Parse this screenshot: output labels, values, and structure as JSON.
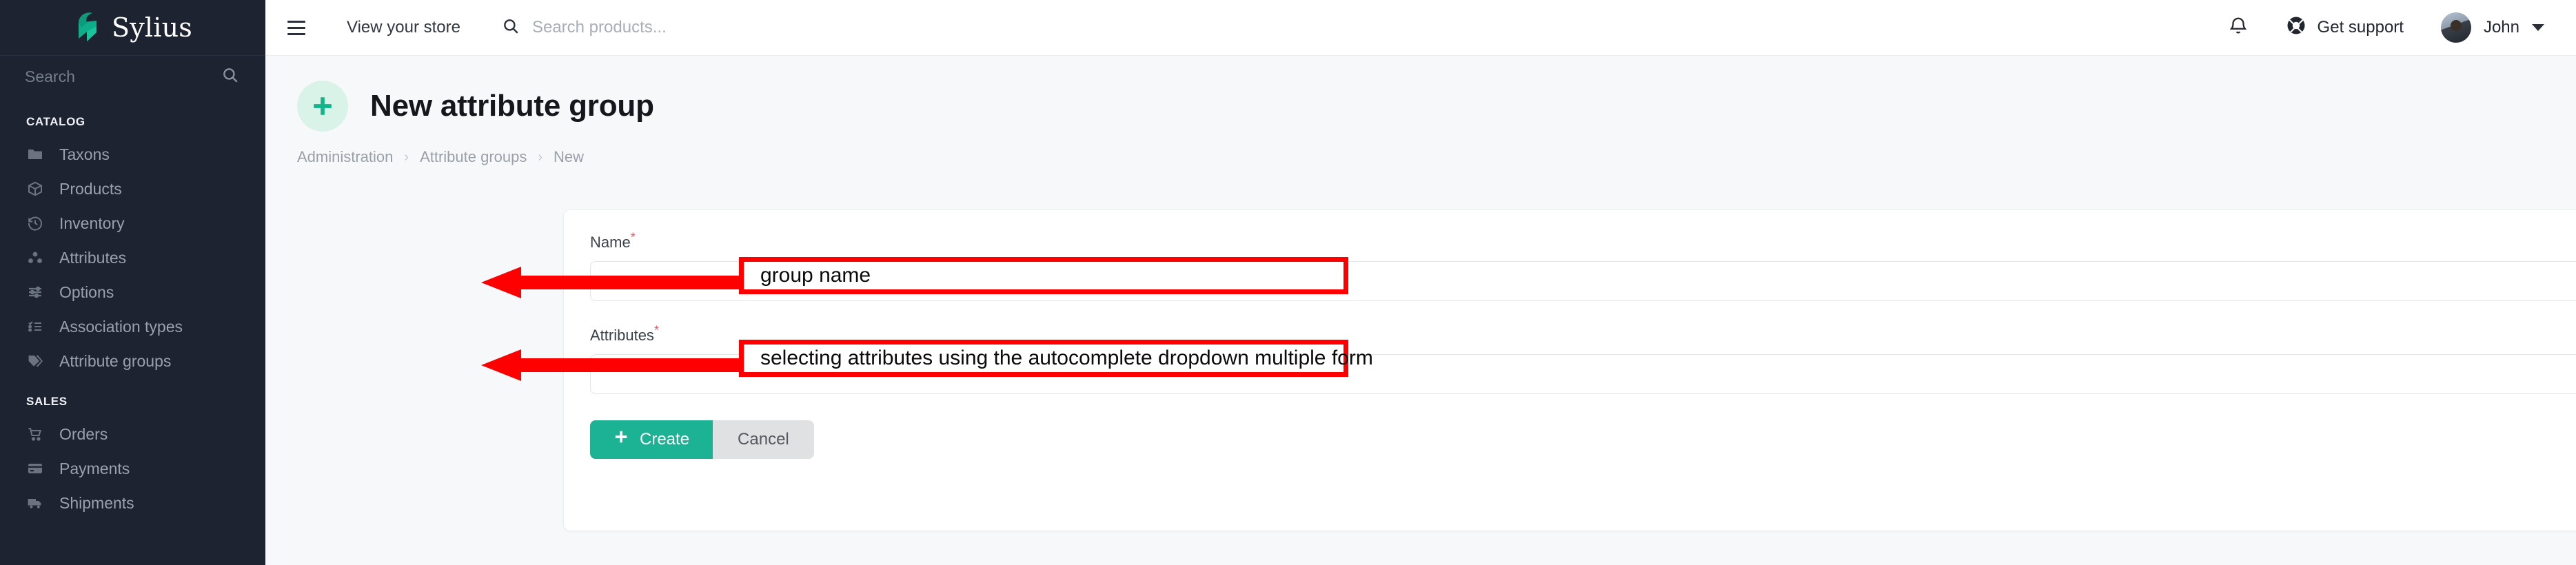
{
  "brand": {
    "name": "Sylius",
    "logo_icon": "sylius-swan-logo",
    "accent": "#1bb394"
  },
  "sidebar": {
    "search": {
      "placeholder": "Search",
      "icon": "search-icon"
    },
    "sections": [
      {
        "title": "CATALOG",
        "items": [
          {
            "label": "Taxons",
            "icon": "folder-icon"
          },
          {
            "label": "Products",
            "icon": "cube-icon"
          },
          {
            "label": "Inventory",
            "icon": "history-icon"
          },
          {
            "label": "Attributes",
            "icon": "atom-icon"
          },
          {
            "label": "Options",
            "icon": "sliders-icon"
          },
          {
            "label": "Association types",
            "icon": "checklist-icon"
          },
          {
            "label": "Attribute groups",
            "icon": "tags-icon"
          }
        ]
      },
      {
        "title": "SALES",
        "items": [
          {
            "label": "Orders",
            "icon": "cart-icon"
          },
          {
            "label": "Payments",
            "icon": "credit-card-icon"
          },
          {
            "label": "Shipments",
            "icon": "truck-icon"
          }
        ]
      }
    ]
  },
  "topbar": {
    "menu_icon": "hamburger-icon",
    "view_store_label": "View your store",
    "search": {
      "placeholder": "Search products...",
      "icon": "search-icon"
    },
    "notifications_icon": "bell-icon",
    "support": {
      "label": "Get support",
      "icon": "lifebuoy-icon"
    },
    "user": {
      "name": "John",
      "avatar": "user-avatar",
      "caret": "chevron-down-icon"
    }
  },
  "page": {
    "icon": "plus-icon",
    "title": "New attribute group",
    "breadcrumb": [
      {
        "label": "Administration"
      },
      {
        "label": "Attribute groups"
      },
      {
        "label": "New"
      }
    ],
    "breadcrumb_separator": "›"
  },
  "form": {
    "name_field": {
      "label": "Name",
      "required_mark": "*",
      "value": "",
      "placeholder": ""
    },
    "attributes_field": {
      "label": "Attributes",
      "required_mark": "*",
      "value": "",
      "placeholder": "",
      "caret_icon": "chevron-down-icon"
    },
    "create_button": {
      "label": "Create",
      "icon": "plus-icon"
    },
    "cancel_button": {
      "label": "Cancel"
    }
  },
  "annotations": [
    {
      "text": "group name",
      "color": "#ff0000"
    },
    {
      "text": "selecting attributes using the autocomplete dropdown multiple form",
      "color": "#ff0000"
    }
  ]
}
